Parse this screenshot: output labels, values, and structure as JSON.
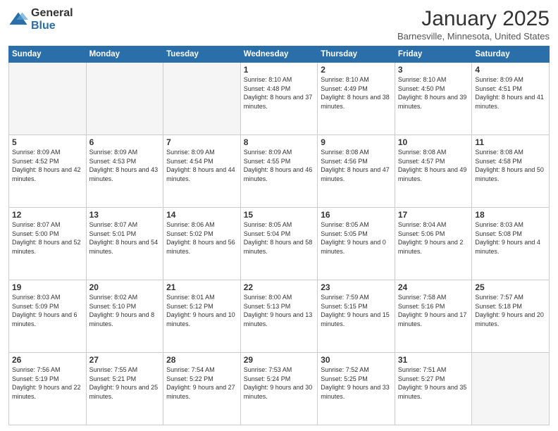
{
  "logo": {
    "general": "General",
    "blue": "Blue"
  },
  "header": {
    "month": "January 2025",
    "location": "Barnesville, Minnesota, United States"
  },
  "weekdays": [
    "Sunday",
    "Monday",
    "Tuesday",
    "Wednesday",
    "Thursday",
    "Friday",
    "Saturday"
  ],
  "weeks": [
    [
      {
        "day": "",
        "empty": true
      },
      {
        "day": "",
        "empty": true
      },
      {
        "day": "",
        "empty": true
      },
      {
        "day": "1",
        "sunrise": "8:10 AM",
        "sunset": "4:48 PM",
        "daylight": "8 hours and 37 minutes."
      },
      {
        "day": "2",
        "sunrise": "8:10 AM",
        "sunset": "4:49 PM",
        "daylight": "8 hours and 38 minutes."
      },
      {
        "day": "3",
        "sunrise": "8:10 AM",
        "sunset": "4:50 PM",
        "daylight": "8 hours and 39 minutes."
      },
      {
        "day": "4",
        "sunrise": "8:09 AM",
        "sunset": "4:51 PM",
        "daylight": "8 hours and 41 minutes."
      }
    ],
    [
      {
        "day": "5",
        "sunrise": "8:09 AM",
        "sunset": "4:52 PM",
        "daylight": "8 hours and 42 minutes."
      },
      {
        "day": "6",
        "sunrise": "8:09 AM",
        "sunset": "4:53 PM",
        "daylight": "8 hours and 43 minutes."
      },
      {
        "day": "7",
        "sunrise": "8:09 AM",
        "sunset": "4:54 PM",
        "daylight": "8 hours and 44 minutes."
      },
      {
        "day": "8",
        "sunrise": "8:09 AM",
        "sunset": "4:55 PM",
        "daylight": "8 hours and 46 minutes."
      },
      {
        "day": "9",
        "sunrise": "8:08 AM",
        "sunset": "4:56 PM",
        "daylight": "8 hours and 47 minutes."
      },
      {
        "day": "10",
        "sunrise": "8:08 AM",
        "sunset": "4:57 PM",
        "daylight": "8 hours and 49 minutes."
      },
      {
        "day": "11",
        "sunrise": "8:08 AM",
        "sunset": "4:58 PM",
        "daylight": "8 hours and 50 minutes."
      }
    ],
    [
      {
        "day": "12",
        "sunrise": "8:07 AM",
        "sunset": "5:00 PM",
        "daylight": "8 hours and 52 minutes."
      },
      {
        "day": "13",
        "sunrise": "8:07 AM",
        "sunset": "5:01 PM",
        "daylight": "8 hours and 54 minutes."
      },
      {
        "day": "14",
        "sunrise": "8:06 AM",
        "sunset": "5:02 PM",
        "daylight": "8 hours and 56 minutes."
      },
      {
        "day": "15",
        "sunrise": "8:05 AM",
        "sunset": "5:04 PM",
        "daylight": "8 hours and 58 minutes."
      },
      {
        "day": "16",
        "sunrise": "8:05 AM",
        "sunset": "5:05 PM",
        "daylight": "9 hours and 0 minutes."
      },
      {
        "day": "17",
        "sunrise": "8:04 AM",
        "sunset": "5:06 PM",
        "daylight": "9 hours and 2 minutes."
      },
      {
        "day": "18",
        "sunrise": "8:03 AM",
        "sunset": "5:08 PM",
        "daylight": "9 hours and 4 minutes."
      }
    ],
    [
      {
        "day": "19",
        "sunrise": "8:03 AM",
        "sunset": "5:09 PM",
        "daylight": "9 hours and 6 minutes."
      },
      {
        "day": "20",
        "sunrise": "8:02 AM",
        "sunset": "5:10 PM",
        "daylight": "9 hours and 8 minutes."
      },
      {
        "day": "21",
        "sunrise": "8:01 AM",
        "sunset": "5:12 PM",
        "daylight": "9 hours and 10 minutes."
      },
      {
        "day": "22",
        "sunrise": "8:00 AM",
        "sunset": "5:13 PM",
        "daylight": "9 hours and 13 minutes."
      },
      {
        "day": "23",
        "sunrise": "7:59 AM",
        "sunset": "5:15 PM",
        "daylight": "9 hours and 15 minutes."
      },
      {
        "day": "24",
        "sunrise": "7:58 AM",
        "sunset": "5:16 PM",
        "daylight": "9 hours and 17 minutes."
      },
      {
        "day": "25",
        "sunrise": "7:57 AM",
        "sunset": "5:18 PM",
        "daylight": "9 hours and 20 minutes."
      }
    ],
    [
      {
        "day": "26",
        "sunrise": "7:56 AM",
        "sunset": "5:19 PM",
        "daylight": "9 hours and 22 minutes."
      },
      {
        "day": "27",
        "sunrise": "7:55 AM",
        "sunset": "5:21 PM",
        "daylight": "9 hours and 25 minutes."
      },
      {
        "day": "28",
        "sunrise": "7:54 AM",
        "sunset": "5:22 PM",
        "daylight": "9 hours and 27 minutes."
      },
      {
        "day": "29",
        "sunrise": "7:53 AM",
        "sunset": "5:24 PM",
        "daylight": "9 hours and 30 minutes."
      },
      {
        "day": "30",
        "sunrise": "7:52 AM",
        "sunset": "5:25 PM",
        "daylight": "9 hours and 33 minutes."
      },
      {
        "day": "31",
        "sunrise": "7:51 AM",
        "sunset": "5:27 PM",
        "daylight": "9 hours and 35 minutes."
      },
      {
        "day": "",
        "empty": true
      }
    ]
  ]
}
